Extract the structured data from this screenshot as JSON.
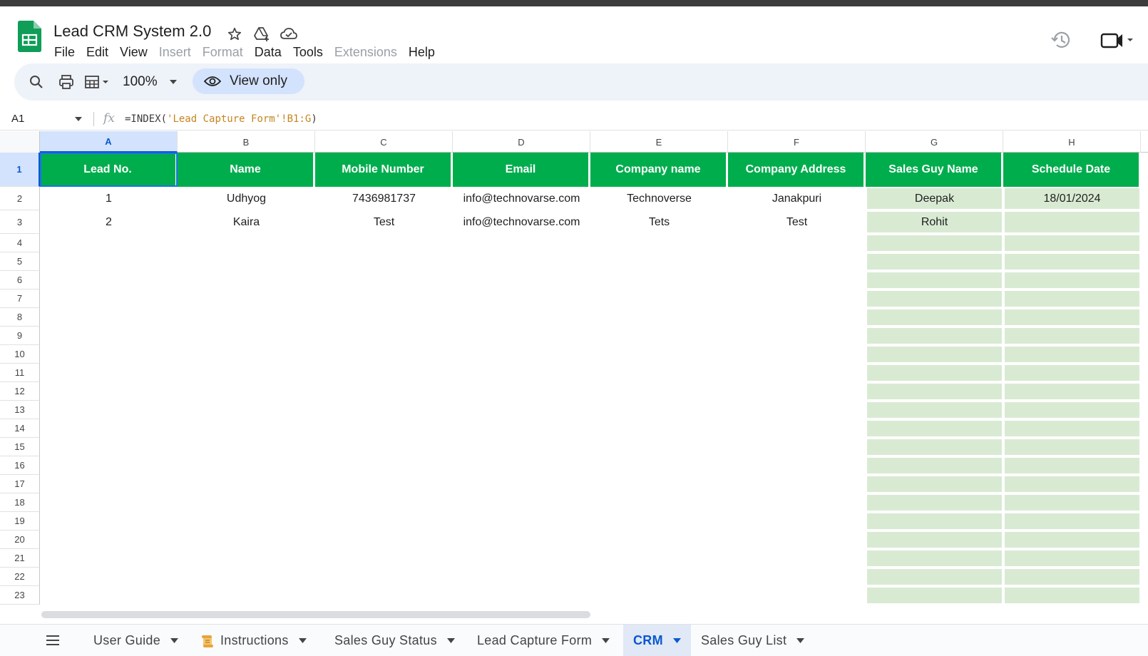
{
  "app": {
    "doc_title": "Lead CRM System 2.0",
    "icons": [
      "star-icon",
      "move-to-drive-icon",
      "cloud-status-icon",
      "version-history-icon",
      "meet-icon"
    ]
  },
  "menu": {
    "file": "File",
    "edit": "Edit",
    "view": "View",
    "insert": "Insert",
    "format": "Format",
    "data": "Data",
    "tools": "Tools",
    "extensions": "Extensions",
    "help": "Help"
  },
  "toolbar": {
    "zoom": "100%",
    "view_only": "View only"
  },
  "formula_bar": {
    "cell_ref": "A1",
    "fx": "fx",
    "formula_prefix": "=INDEX(",
    "formula_string": "'Lead Capture Form'!B1:G",
    "formula_suffix": ")"
  },
  "columns": [
    "A",
    "B",
    "C",
    "D",
    "E",
    "F",
    "G",
    "H"
  ],
  "rows": [
    "1",
    "2",
    "3",
    "4",
    "5",
    "6",
    "7",
    "8",
    "9",
    "10",
    "11",
    "12",
    "13",
    "14",
    "15",
    "16",
    "17",
    "18",
    "19",
    "20",
    "21",
    "22",
    "23"
  ],
  "table": {
    "headers": [
      "Lead No.",
      "Name",
      "Mobile Number",
      "Email",
      "Company name",
      "Company Address",
      "Sales Guy Name",
      "Schedule Date"
    ],
    "data": [
      [
        "1",
        "Udhyog",
        "7436981737",
        "info@technovarse.com",
        "Technoverse",
        "Janakpuri",
        "Deepak",
        "18/01/2024"
      ],
      [
        "2",
        "Kaira",
        "Test",
        "info@technovarse.com",
        "Tets",
        "Test",
        "Rohit",
        ""
      ]
    ]
  },
  "colors": {
    "header_green": "#00ad4d",
    "light_green": "#d9ead3",
    "selection_blue": "#d3e3fd"
  },
  "sheet_tabs": {
    "user_guide": "User Guide",
    "instructions": "Instructions",
    "sales_guy_status": "Sales Guy Status",
    "lead_capture_form": "Lead Capture Form",
    "crm": "CRM",
    "sales_guy_list": "Sales Guy List",
    "active": "CRM"
  }
}
